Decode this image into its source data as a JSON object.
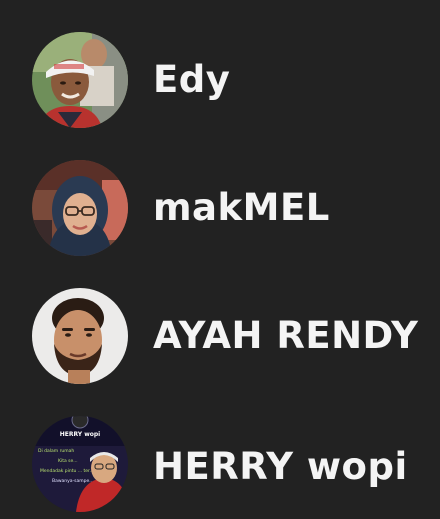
{
  "contacts": [
    {
      "name": "Edy",
      "avatar": "photo-man-white-cap"
    },
    {
      "name": "makMEL",
      "avatar": "photo-woman-hijab"
    },
    {
      "name": "AYAH RENDY",
      "avatar": "photo-bearded-man"
    },
    {
      "name": "HERRY wopi",
      "avatar": "photo-poster-man",
      "avatar_text": [
        "HERRY wopi",
        "Di dalam rumah",
        "Kita se...",
        "Mendadak pintu ... ter...",
        "Bawanya-sampe..."
      ]
    }
  ],
  "colors": {
    "background": "#222222",
    "name_text": "#f4f4f4"
  }
}
